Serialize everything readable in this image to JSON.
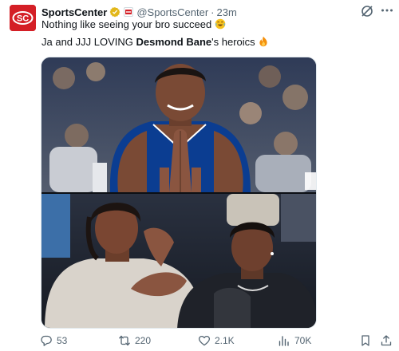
{
  "tweet": {
    "author": {
      "display_name": "SportsCenter",
      "handle": "@SportsCenter",
      "avatar_text": "SC",
      "avatar_color": "#d41f26",
      "verified_badge": "gold-verified-badge",
      "affiliate_badge": "espn-affiliate-badge"
    },
    "separator": "·",
    "timestamp": "23m",
    "text_line1": "Nothing like seeing your bro succeed",
    "text_line1_emoji": "😂",
    "text_line2_prefix": "Ja and JJJ LOVING ",
    "text_line2_bold": "Desmond Bane",
    "text_line2_suffix": "'s heroics",
    "text_line2_emoji": "🔥",
    "media": {
      "top_panel": "player-praying-hands-photo",
      "bottom_panel": "courtside-fans-photo"
    },
    "actions": {
      "reply_count": "53",
      "retweet_count": "220",
      "like_count": "2.1K",
      "views_count": "70K"
    }
  },
  "colors": {
    "text": "#0f1419",
    "secondary_text": "#536471",
    "brand_red": "#d41f26",
    "verified_gold": "#e2b719"
  }
}
